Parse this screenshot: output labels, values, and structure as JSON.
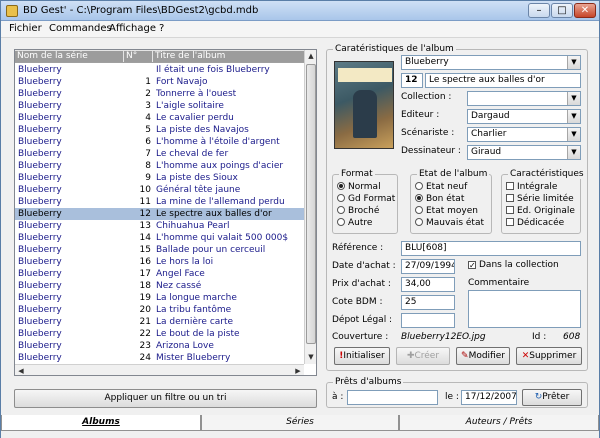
{
  "window": {
    "title": "BD Gest' - C:\\Program Files\\BDGest2\\gcbd.mdb",
    "min": "–",
    "max": "□",
    "close": "✕"
  },
  "menu": [
    "Fichier",
    "Commandes",
    "Affichage",
    "?"
  ],
  "grid": {
    "headers": [
      "Nom de la série",
      "N°",
      "Titre de l'album"
    ],
    "rows": [
      [
        "Blueberry",
        "",
        "Il était une fois Blueberry"
      ],
      [
        "Blueberry",
        "1",
        "Fort Navajo"
      ],
      [
        "Blueberry",
        "2",
        "Tonnerre à l'ouest"
      ],
      [
        "Blueberry",
        "3",
        "L'aigle solitaire"
      ],
      [
        "Blueberry",
        "4",
        "Le cavalier perdu"
      ],
      [
        "Blueberry",
        "5",
        "La piste des Navajos"
      ],
      [
        "Blueberry",
        "6",
        "L'homme à l'étoile d'argent"
      ],
      [
        "Blueberry",
        "7",
        "Le cheval de fer"
      ],
      [
        "Blueberry",
        "8",
        "L'homme aux poings d'acier"
      ],
      [
        "Blueberry",
        "9",
        "La piste des Sioux"
      ],
      [
        "Blueberry",
        "10",
        "Général tête jaune"
      ],
      [
        "Blueberry",
        "11",
        "La mine de l'allemand perdu"
      ],
      [
        "Blueberry",
        "12",
        "Le spectre aux balles d'or"
      ],
      [
        "Blueberry",
        "13",
        "Chihuahua Pearl"
      ],
      [
        "Blueberry",
        "14",
        "L'homme qui valait 500 000$"
      ],
      [
        "Blueberry",
        "15",
        "Ballade pour un cerceuil"
      ],
      [
        "Blueberry",
        "16",
        "Le hors la loi"
      ],
      [
        "Blueberry",
        "17",
        "Angel Face"
      ],
      [
        "Blueberry",
        "18",
        "Nez cassé"
      ],
      [
        "Blueberry",
        "19",
        "La longue marche"
      ],
      [
        "Blueberry",
        "20",
        "La tribu fantôme"
      ],
      [
        "Blueberry",
        "21",
        "La dernière carte"
      ],
      [
        "Blueberry",
        "22",
        "Le bout de la piste"
      ],
      [
        "Blueberry",
        "23",
        "Arizona Love"
      ],
      [
        "Blueberry",
        "24",
        "Mister Blueberry"
      ]
    ],
    "selected_index": 12
  },
  "filter_button": "Appliquer un filtre ou un tri",
  "album": {
    "legend": "Caratéristiques de l'album",
    "serie": "Blueberry",
    "numero": "12",
    "titre": "Le spectre aux balles d'or",
    "collection_label": "Collection :",
    "collection": "",
    "editeur_label": "Editeur :",
    "editeur": "Dargaud",
    "scenariste_label": "Scénariste :",
    "scenariste": "Charlier",
    "dessinateur_label": "Dessinateur :",
    "dessinateur": "Giraud"
  },
  "format": {
    "legend": "Format",
    "options": [
      "Normal",
      "Gd Format",
      "Broché",
      "Autre"
    ],
    "selected": 0
  },
  "etat": {
    "legend": "Etat de l'album",
    "options": [
      "Etat neuf",
      "Bon état",
      "Etat moyen",
      "Mauvais état"
    ],
    "selected": 1
  },
  "caract": {
    "legend": "Caractéristiques",
    "options": [
      "Intégrale",
      "Série limitée",
      "Ed. Originale",
      "Dédicacée"
    ]
  },
  "details": {
    "reference_label": "Référence :",
    "reference": "BLU[608]",
    "date_label": "Date d'achat :",
    "date": "27/09/1994",
    "dans_collection": "Dans la collection",
    "prix_label": "Prix d'achat :",
    "prix": "34,00",
    "commentaire_label": "Commentaire",
    "cote_label": "Cote BDM :",
    "cote": "25",
    "depot_label": "Dépot Légal :",
    "depot": "",
    "couverture_label": "Couverture :",
    "couverture": "Blueberry12EO.jpg",
    "id_label": "Id :",
    "id": "608"
  },
  "buttons": {
    "initialiser": "Initialiser",
    "creer": "Créer",
    "modifier": "Modifier",
    "supprimer": "Supprimer"
  },
  "prets": {
    "legend": "Prêts d'albums",
    "a_label": "à :",
    "a_value": "",
    "le_label": "le :",
    "le_value": "17/12/2007",
    "preter": "Prêter"
  },
  "tabs": [
    "Albums",
    "Séries",
    "Auteurs / Prêts"
  ]
}
